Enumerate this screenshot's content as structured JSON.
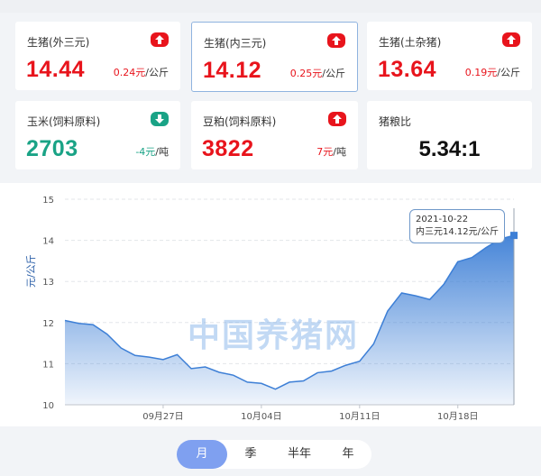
{
  "cards": [
    {
      "label": "生猪(外三元)",
      "value": "14.44",
      "change": "0.24元",
      "unit": "/公斤",
      "trend": "up"
    },
    {
      "label": "生猪(内三元)",
      "value": "14.12",
      "change": "0.25元",
      "unit": "/公斤",
      "trend": "up"
    },
    {
      "label": "生猪(土杂猪)",
      "value": "13.64",
      "change": "0.19元",
      "unit": "/公斤",
      "trend": "up"
    },
    {
      "label": "玉米(饲料原料)",
      "value": "2703",
      "change": "-4元",
      "unit": "/吨",
      "trend": "down"
    },
    {
      "label": "豆粕(饲料原料)",
      "value": "3822",
      "change": "7元",
      "unit": "/吨",
      "trend": "up"
    },
    {
      "label": "猪粮比",
      "value": "5.34:1"
    }
  ],
  "colors": {
    "up": "#e8141c",
    "down": "#1aa386",
    "line": "#3d7fd6",
    "accent": "#7fa0f0"
  },
  "watermark": "中国养猪网",
  "tooltip": {
    "date": "2021-10-22",
    "text": "内三元14.12元/公斤"
  },
  "periods": [
    {
      "label": "月",
      "active": true
    },
    {
      "label": "季",
      "active": false
    },
    {
      "label": "半年",
      "active": false
    },
    {
      "label": "年",
      "active": false
    }
  ],
  "chart_data": {
    "type": "area",
    "ylabel": "元/公斤",
    "ylim": [
      10,
      15
    ],
    "yticks": [
      10,
      11,
      12,
      13,
      14,
      15
    ],
    "xticks": [
      "09月27日",
      "10月04日",
      "10月11日",
      "10月18日"
    ],
    "grid": true,
    "series": [
      {
        "x": [
          "09-20",
          "09-21",
          "09-22",
          "09-23",
          "09-24",
          "09-25",
          "09-26",
          "09-27",
          "09-28",
          "09-29",
          "09-30",
          "10-01",
          "10-02",
          "10-03",
          "10-04",
          "10-05",
          "10-06",
          "10-07",
          "10-08",
          "10-09",
          "10-10",
          "10-11",
          "10-12",
          "10-13",
          "10-14",
          "10-15",
          "10-16",
          "10-17",
          "10-18",
          "10-19",
          "10-20",
          "10-21",
          "10-22"
        ],
        "values": [
          12.05,
          11.98,
          11.95,
          11.72,
          11.38,
          11.2,
          11.16,
          11.1,
          11.22,
          10.88,
          10.92,
          10.79,
          10.72,
          10.55,
          10.52,
          10.38,
          10.55,
          10.58,
          10.78,
          10.82,
          10.96,
          11.06,
          11.48,
          12.28,
          12.72,
          12.65,
          12.56,
          12.93,
          13.48,
          13.58,
          13.82,
          14.03,
          14.12
        ]
      }
    ]
  }
}
